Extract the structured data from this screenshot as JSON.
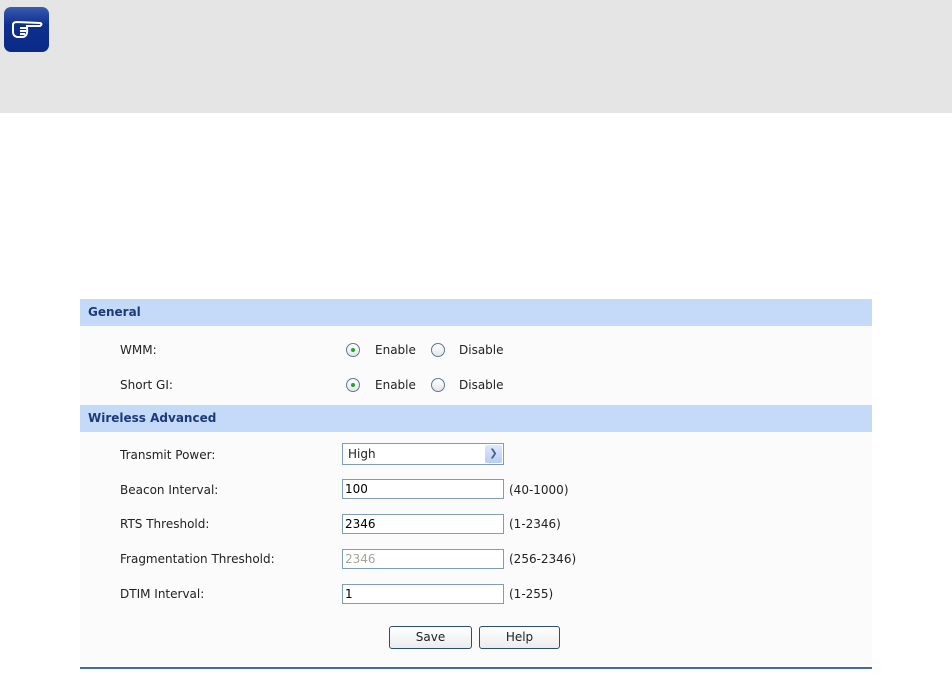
{
  "general": {
    "title": "General",
    "wmm": {
      "label": "WMM:",
      "value": "Enable"
    },
    "short_gi": {
      "label": "Short GI:",
      "value": "Enable"
    },
    "enable_label": "Enable",
    "disable_label": "Disable"
  },
  "advanced": {
    "title": "Wireless Advanced",
    "transmit_power": {
      "label": "Transmit Power:",
      "value": "High"
    },
    "beacon_interval": {
      "label": "Beacon Interval:",
      "value": "100",
      "range": "(40-1000)"
    },
    "rts_threshold": {
      "label": "RTS Threshold:",
      "value": "2346",
      "range": "(1-2346)"
    },
    "fragmentation_threshold": {
      "label": "Fragmentation Threshold:",
      "value": "2346",
      "range": "(256-2346)"
    },
    "dtim_interval": {
      "label": "DTIM Interval:",
      "value": "1",
      "range": "(1-255)"
    }
  },
  "buttons": {
    "save": "Save",
    "help": "Help"
  }
}
